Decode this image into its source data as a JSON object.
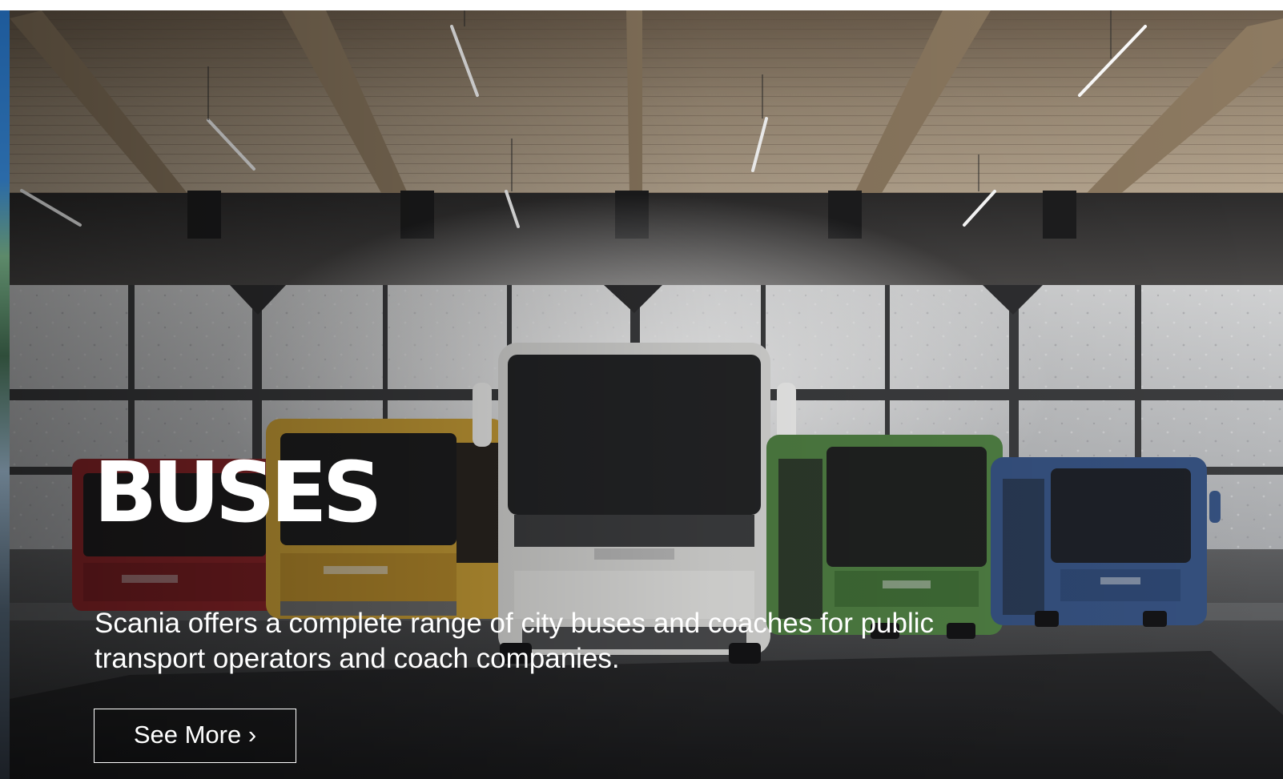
{
  "hero": {
    "title": "BUSES",
    "description": "Scania offers a complete range of city buses and coaches for public transport operators and coach companies.",
    "cta_label": "See More ›",
    "image_subject": "five-buses-in-depot",
    "bus_brand": "SCANIA",
    "bus_colors": [
      "#9a2a2e",
      "#c59a34",
      "#d4d4d2",
      "#4e7d42",
      "#35507e"
    ]
  },
  "colors": {
    "text": "#ffffff",
    "left_strip_accent": "#1e5a9a"
  }
}
